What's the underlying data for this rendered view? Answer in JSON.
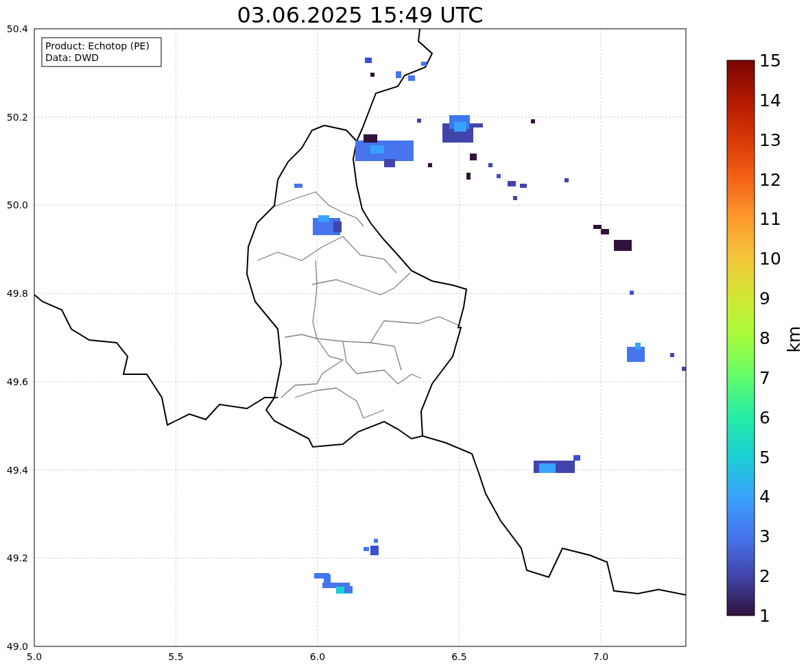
{
  "title": "03.06.2025 15:49 UTC",
  "info_box": {
    "lines": [
      "Product: Echotop (PE)",
      "Data: DWD"
    ]
  },
  "map": {
    "x_tick_labels": [
      "5.0",
      "5.5",
      "6.0",
      "6.5",
      "7.0"
    ],
    "y_tick_labels": [
      "50.4",
      "50.2",
      "50.0",
      "49.8",
      "49.6",
      "49.4",
      "49.2",
      "49.0"
    ]
  },
  "colorbar": {
    "label": "km",
    "tick_labels": [
      "15",
      "14",
      "13",
      "12",
      "11",
      "10",
      "9",
      "8",
      "7",
      "6",
      "5",
      "4",
      "3",
      "2",
      "1"
    ]
  }
}
